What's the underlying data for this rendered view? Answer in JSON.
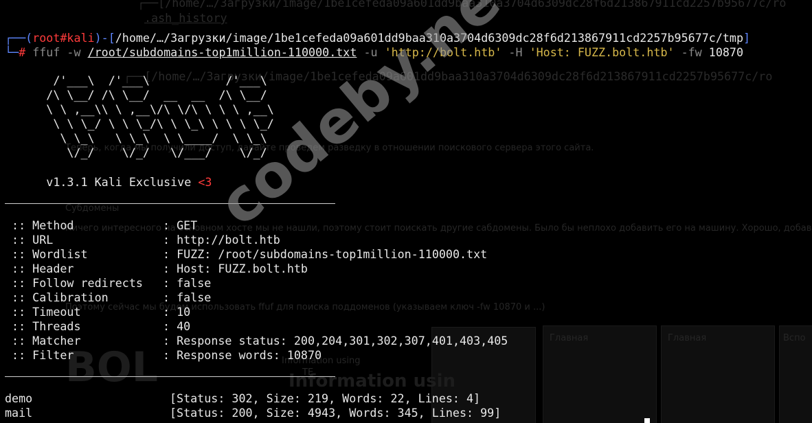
{
  "prompt": {
    "user": "root",
    "host": "kali",
    "path": "/home/…/Загрузки/image/1be1cefeda09a601dd9baa310a3704d6309dc28f6d213867911cd2257b95677c/tmp",
    "symbol": "#"
  },
  "command": {
    "program": "ffuf",
    "flag_w": "-w",
    "wordlist_arg": "/root/subdomains-top1million-110000.txt",
    "flag_u": "-u",
    "url_arg": "'http://bolt.htb'",
    "flag_h": "-H",
    "header_arg": "'Host: FUZZ.bolt.htb'",
    "flag_fw": "-fw",
    "fw_arg": "10870"
  },
  "banner": {
    "art": "       /'___\\  /'___\\           /'___\\\n      /\\ \\__/ /\\ \\__/  __  __  /\\ \\__/\n      \\ \\ ,__\\\\ \\ ,__\\/\\ \\/\\ \\ \\ \\ ,__\\\n       \\ \\ \\_/ \\ \\ \\_/\\ \\ \\_\\ \\ \\ \\ \\_/\n        \\ \\_\\   \\ \\_\\  \\ \\____/  \\ \\_\\\n         \\/_/    \\/_/   \\/___/    \\/_/",
    "version": "v1.3.1 Kali Exclusive",
    "heart": "<3"
  },
  "options": [
    {
      "key": " :: Method",
      "value": ": GET"
    },
    {
      "key": " :: URL",
      "value": ": http://bolt.htb"
    },
    {
      "key": " :: Wordlist",
      "value": ": FUZZ: /root/subdomains-top1million-110000.txt"
    },
    {
      "key": " :: Header",
      "value": ": Host: FUZZ.bolt.htb"
    },
    {
      "key": " :: Follow redirects",
      "value": ": false"
    },
    {
      "key": " :: Calibration",
      "value": ": false"
    },
    {
      "key": " :: Timeout",
      "value": ": 10"
    },
    {
      "key": " :: Threads",
      "value": ": 40"
    },
    {
      "key": " :: Matcher",
      "value": ": Response status: 200,204,301,302,307,401,403,405"
    },
    {
      "key": " :: Filter",
      "value": ": Response words: 10870"
    }
  ],
  "results": [
    {
      "word": "demo",
      "info": "[Status: 302, Size: 219, Words: 22, Lines: 4]"
    },
    {
      "word": "mail",
      "info": "[Status: 200, Size: 4943, Words: 345, Lines: 99]"
    }
  ],
  "watermark": "codeby.net",
  "colors": {
    "prompt_frame": "#5f87ff",
    "prompt_user": "#ff3b3b",
    "flags": "#8a8a8a",
    "strings": "#d7b84a",
    "background": "#000000",
    "text": "#e8e8e8"
  }
}
